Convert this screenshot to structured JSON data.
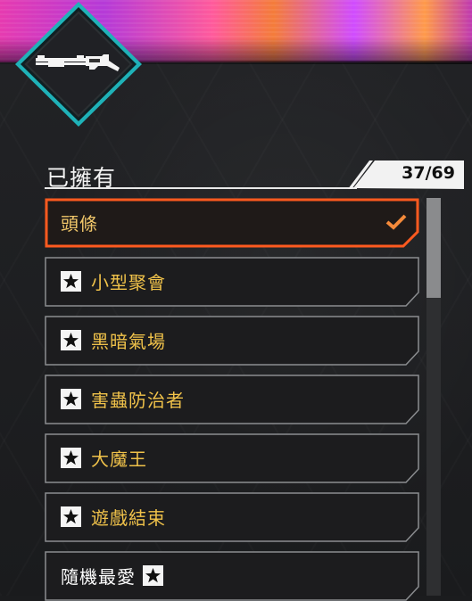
{
  "section": {
    "title": "已擁有",
    "counter": "37/69"
  },
  "items": [
    {
      "label": "頭條",
      "starred": false,
      "selected": true
    },
    {
      "label": "小型聚會",
      "starred": true,
      "selected": false
    },
    {
      "label": "黑暗氣場",
      "starred": true,
      "selected": false
    },
    {
      "label": "害蟲防治者",
      "starred": true,
      "selected": false
    },
    {
      "label": "大魔王",
      "starred": true,
      "selected": false
    },
    {
      "label": "遊戲結束",
      "starred": true,
      "selected": false
    },
    {
      "label": "隨機最愛",
      "starred": true,
      "selected": false,
      "star_after": true
    }
  ],
  "colors": {
    "accent_orange": "#ff5a1f",
    "check_orange": "#f58a3a",
    "label_gold": "#f0c24a",
    "frame_grey": "#8b8d90",
    "diamond_teal": "#1fb2b8"
  },
  "icons": {
    "weapon": "shotgun-icon",
    "star": "star-icon",
    "check": "checkmark-icon"
  },
  "scrollbar": {
    "position": 0
  }
}
